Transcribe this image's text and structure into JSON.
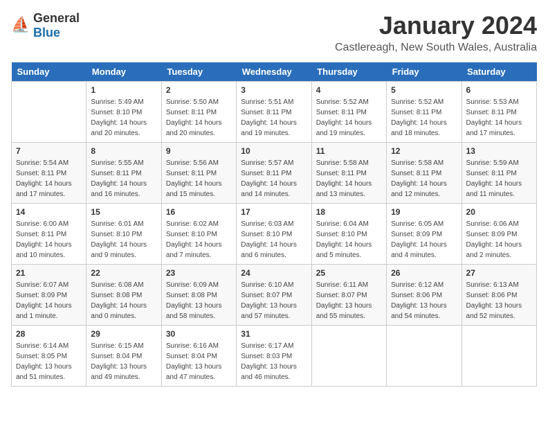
{
  "logo": {
    "text_general": "General",
    "text_blue": "Blue"
  },
  "title": "January 2024",
  "subtitle": "Castlereagh, New South Wales, Australia",
  "weekdays": [
    "Sunday",
    "Monday",
    "Tuesday",
    "Wednesday",
    "Thursday",
    "Friday",
    "Saturday"
  ],
  "weeks": [
    [
      {
        "day": "",
        "sunrise": "",
        "sunset": "",
        "daylight": ""
      },
      {
        "day": "1",
        "sunrise": "Sunrise: 5:49 AM",
        "sunset": "Sunset: 8:10 PM",
        "daylight": "Daylight: 14 hours and 20 minutes."
      },
      {
        "day": "2",
        "sunrise": "Sunrise: 5:50 AM",
        "sunset": "Sunset: 8:11 PM",
        "daylight": "Daylight: 14 hours and 20 minutes."
      },
      {
        "day": "3",
        "sunrise": "Sunrise: 5:51 AM",
        "sunset": "Sunset: 8:11 PM",
        "daylight": "Daylight: 14 hours and 19 minutes."
      },
      {
        "day": "4",
        "sunrise": "Sunrise: 5:52 AM",
        "sunset": "Sunset: 8:11 PM",
        "daylight": "Daylight: 14 hours and 19 minutes."
      },
      {
        "day": "5",
        "sunrise": "Sunrise: 5:52 AM",
        "sunset": "Sunset: 8:11 PM",
        "daylight": "Daylight: 14 hours and 18 minutes."
      },
      {
        "day": "6",
        "sunrise": "Sunrise: 5:53 AM",
        "sunset": "Sunset: 8:11 PM",
        "daylight": "Daylight: 14 hours and 17 minutes."
      }
    ],
    [
      {
        "day": "7",
        "sunrise": "Sunrise: 5:54 AM",
        "sunset": "Sunset: 8:11 PM",
        "daylight": "Daylight: 14 hours and 17 minutes."
      },
      {
        "day": "8",
        "sunrise": "Sunrise: 5:55 AM",
        "sunset": "Sunset: 8:11 PM",
        "daylight": "Daylight: 14 hours and 16 minutes."
      },
      {
        "day": "9",
        "sunrise": "Sunrise: 5:56 AM",
        "sunset": "Sunset: 8:11 PM",
        "daylight": "Daylight: 14 hours and 15 minutes."
      },
      {
        "day": "10",
        "sunrise": "Sunrise: 5:57 AM",
        "sunset": "Sunset: 8:11 PM",
        "daylight": "Daylight: 14 hours and 14 minutes."
      },
      {
        "day": "11",
        "sunrise": "Sunrise: 5:58 AM",
        "sunset": "Sunset: 8:11 PM",
        "daylight": "Daylight: 14 hours and 13 minutes."
      },
      {
        "day": "12",
        "sunrise": "Sunrise: 5:58 AM",
        "sunset": "Sunset: 8:11 PM",
        "daylight": "Daylight: 14 hours and 12 minutes."
      },
      {
        "day": "13",
        "sunrise": "Sunrise: 5:59 AM",
        "sunset": "Sunset: 8:11 PM",
        "daylight": "Daylight: 14 hours and 11 minutes."
      }
    ],
    [
      {
        "day": "14",
        "sunrise": "Sunrise: 6:00 AM",
        "sunset": "Sunset: 8:11 PM",
        "daylight": "Daylight: 14 hours and 10 minutes."
      },
      {
        "day": "15",
        "sunrise": "Sunrise: 6:01 AM",
        "sunset": "Sunset: 8:10 PM",
        "daylight": "Daylight: 14 hours and 9 minutes."
      },
      {
        "day": "16",
        "sunrise": "Sunrise: 6:02 AM",
        "sunset": "Sunset: 8:10 PM",
        "daylight": "Daylight: 14 hours and 7 minutes."
      },
      {
        "day": "17",
        "sunrise": "Sunrise: 6:03 AM",
        "sunset": "Sunset: 8:10 PM",
        "daylight": "Daylight: 14 hours and 6 minutes."
      },
      {
        "day": "18",
        "sunrise": "Sunrise: 6:04 AM",
        "sunset": "Sunset: 8:10 PM",
        "daylight": "Daylight: 14 hours and 5 minutes."
      },
      {
        "day": "19",
        "sunrise": "Sunrise: 6:05 AM",
        "sunset": "Sunset: 8:09 PM",
        "daylight": "Daylight: 14 hours and 4 minutes."
      },
      {
        "day": "20",
        "sunrise": "Sunrise: 6:06 AM",
        "sunset": "Sunset: 8:09 PM",
        "daylight": "Daylight: 14 hours and 2 minutes."
      }
    ],
    [
      {
        "day": "21",
        "sunrise": "Sunrise: 6:07 AM",
        "sunset": "Sunset: 8:09 PM",
        "daylight": "Daylight: 14 hours and 1 minute."
      },
      {
        "day": "22",
        "sunrise": "Sunrise: 6:08 AM",
        "sunset": "Sunset: 8:08 PM",
        "daylight": "Daylight: 14 hours and 0 minutes."
      },
      {
        "day": "23",
        "sunrise": "Sunrise: 6:09 AM",
        "sunset": "Sunset: 8:08 PM",
        "daylight": "Daylight: 13 hours and 58 minutes."
      },
      {
        "day": "24",
        "sunrise": "Sunrise: 6:10 AM",
        "sunset": "Sunset: 8:07 PM",
        "daylight": "Daylight: 13 hours and 57 minutes."
      },
      {
        "day": "25",
        "sunrise": "Sunrise: 6:11 AM",
        "sunset": "Sunset: 8:07 PM",
        "daylight": "Daylight: 13 hours and 55 minutes."
      },
      {
        "day": "26",
        "sunrise": "Sunrise: 6:12 AM",
        "sunset": "Sunset: 8:06 PM",
        "daylight": "Daylight: 13 hours and 54 minutes."
      },
      {
        "day": "27",
        "sunrise": "Sunrise: 6:13 AM",
        "sunset": "Sunset: 8:06 PM",
        "daylight": "Daylight: 13 hours and 52 minutes."
      }
    ],
    [
      {
        "day": "28",
        "sunrise": "Sunrise: 6:14 AM",
        "sunset": "Sunset: 8:05 PM",
        "daylight": "Daylight: 13 hours and 51 minutes."
      },
      {
        "day": "29",
        "sunrise": "Sunrise: 6:15 AM",
        "sunset": "Sunset: 8:04 PM",
        "daylight": "Daylight: 13 hours and 49 minutes."
      },
      {
        "day": "30",
        "sunrise": "Sunrise: 6:16 AM",
        "sunset": "Sunset: 8:04 PM",
        "daylight": "Daylight: 13 hours and 47 minutes."
      },
      {
        "day": "31",
        "sunrise": "Sunrise: 6:17 AM",
        "sunset": "Sunset: 8:03 PM",
        "daylight": "Daylight: 13 hours and 46 minutes."
      },
      {
        "day": "",
        "sunrise": "",
        "sunset": "",
        "daylight": ""
      },
      {
        "day": "",
        "sunrise": "",
        "sunset": "",
        "daylight": ""
      },
      {
        "day": "",
        "sunrise": "",
        "sunset": "",
        "daylight": ""
      }
    ]
  ]
}
